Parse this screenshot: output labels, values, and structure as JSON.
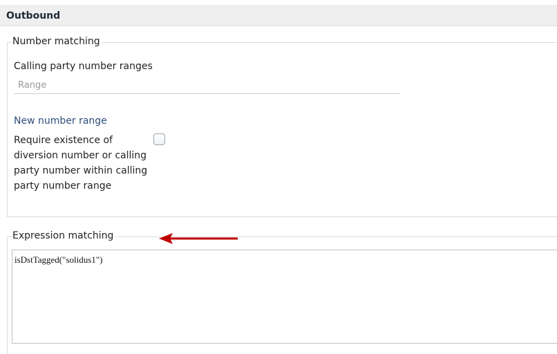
{
  "section": {
    "title": "Outbound"
  },
  "number_matching": {
    "legend": "Number matching",
    "calling_party_label": "Calling party number ranges",
    "range_placeholder": "Range",
    "new_range_link": "New number range",
    "require_label": "Require existence of diversion number or calling party number within calling party number range",
    "require_checked": false
  },
  "expression_matching": {
    "legend": "Expression matching",
    "value": "isDstTagged(\"solidus1\")"
  },
  "colors": {
    "arrow": "#c00000",
    "link": "#2e4d7a",
    "header_bg": "#efefef"
  },
  "annotation": {
    "icon": "red-left-arrow-icon"
  }
}
